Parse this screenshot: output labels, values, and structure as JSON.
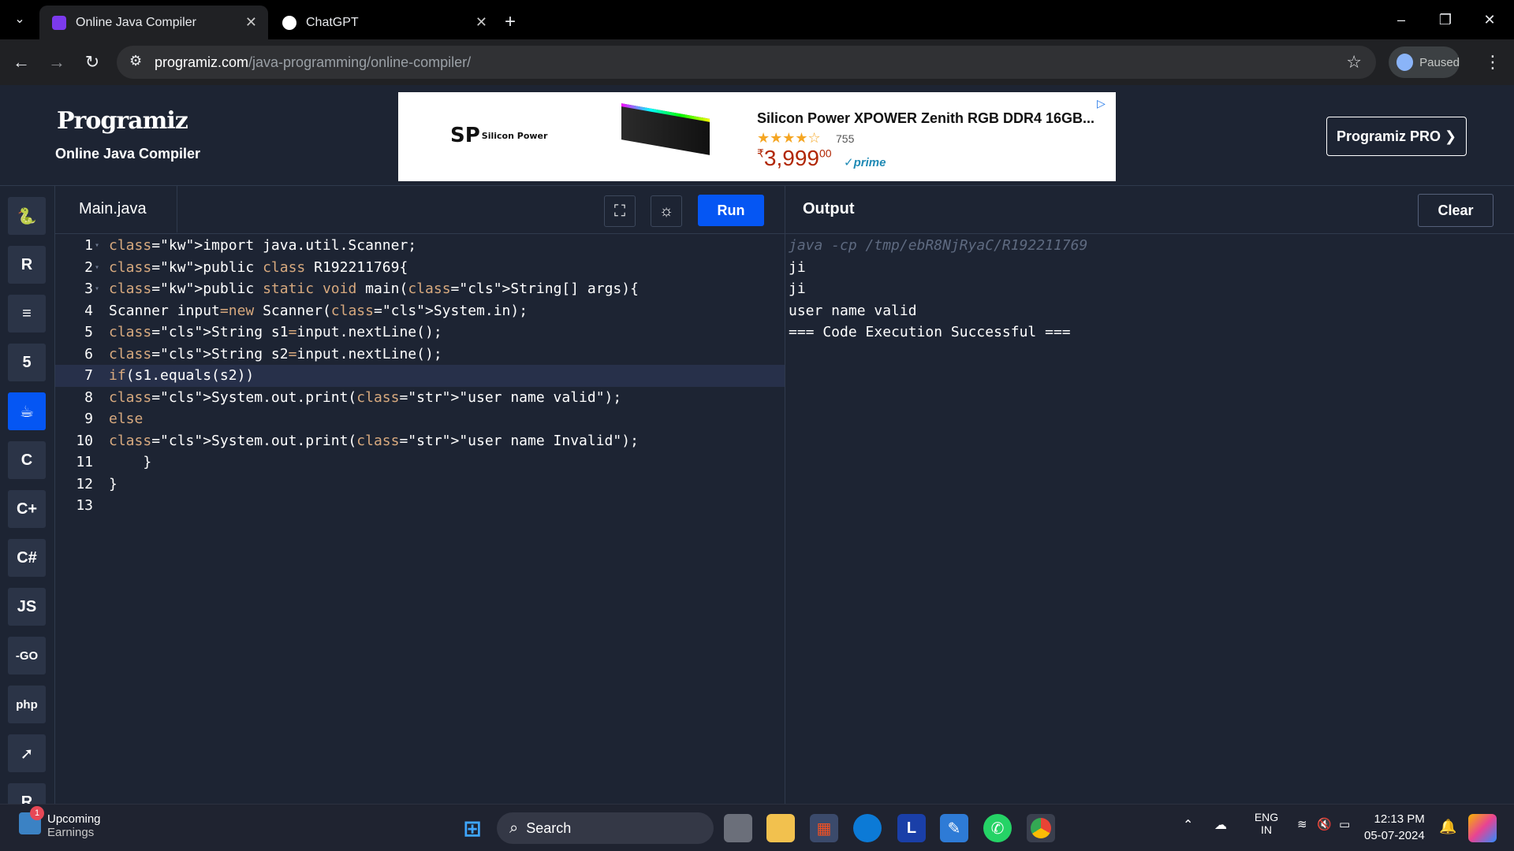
{
  "browser": {
    "tabs": [
      {
        "title": "Online Java Compiler",
        "favicon_color": "#7c3aed"
      },
      {
        "title": "ChatGPT",
        "favicon_color": "#ffffff"
      }
    ],
    "url_domain": "programiz.com",
    "url_path": "/java-programming/online-compiler/",
    "profile_status": "Paused",
    "window_controls": {
      "minimize": "–",
      "restore": "❐",
      "close": "✕"
    }
  },
  "header": {
    "logo": "Programiz",
    "subtitle": "Online Java Compiler",
    "pro_button": "Programiz PRO ❯",
    "ad": {
      "brand": "SP",
      "brand_sub": "Silicon Power",
      "title": "Silicon Power XPOWER Zenith RGB DDR4 16GB...",
      "stars": "★★★★☆",
      "rating_count": "755",
      "price_symbol": "₹",
      "price": "3,999",
      "price_cents": "00",
      "prime": "✓prime"
    }
  },
  "rail": {
    "languages": [
      {
        "name": "python",
        "glyph": "🐍",
        "active": false
      },
      {
        "name": "r",
        "glyph": "R",
        "active": false
      },
      {
        "name": "sql",
        "glyph": "≡",
        "active": false
      },
      {
        "name": "html",
        "glyph": "5",
        "active": false
      },
      {
        "name": "java",
        "glyph": "☕",
        "active": true
      },
      {
        "name": "c",
        "glyph": "C",
        "active": false
      },
      {
        "name": "cpp",
        "glyph": "C+",
        "active": false
      },
      {
        "name": "csharp",
        "glyph": "C#",
        "active": false
      },
      {
        "name": "js",
        "glyph": "JS",
        "active": false
      },
      {
        "name": "go",
        "glyph": "-GO",
        "active": false
      },
      {
        "name": "php",
        "glyph": "php",
        "active": false
      },
      {
        "name": "swift",
        "glyph": "➚",
        "active": false
      },
      {
        "name": "rust",
        "glyph": "R",
        "active": false
      }
    ]
  },
  "editor": {
    "filename": "Main.java",
    "run_label": "Run",
    "fullscreen_icon": "⛶",
    "theme_icon": "☼",
    "lines": [
      {
        "n": "1",
        "fold": "▾",
        "code": "import java.util.Scanner;"
      },
      {
        "n": "2",
        "fold": "▾",
        "code": "public class R192211769{"
      },
      {
        "n": "3",
        "fold": "▾",
        "code": "public static void main(String[] args){"
      },
      {
        "n": "4",
        "fold": "",
        "code": "Scanner input=new Scanner(System.in);"
      },
      {
        "n": "5",
        "fold": "",
        "code": "String s1=input.nextLine();"
      },
      {
        "n": "6",
        "fold": "",
        "code": "String s2=input.nextLine();"
      },
      {
        "n": "7",
        "fold": "",
        "code": "if(s1.equals(s2))"
      },
      {
        "n": "8",
        "fold": "",
        "code": "System.out.print(\"user name valid\");"
      },
      {
        "n": "9",
        "fold": "",
        "code": "else"
      },
      {
        "n": "10",
        "fold": "",
        "code": "System.out.print(\"user name Invalid\");"
      },
      {
        "n": "11",
        "fold": "",
        "code": "    }"
      },
      {
        "n": "12",
        "fold": "",
        "code": "}"
      },
      {
        "n": "13",
        "fold": "",
        "code": ""
      }
    ],
    "highlighted_line": 7
  },
  "output": {
    "title": "Output",
    "clear_label": "Clear",
    "command": "java -cp /tmp/ebR8NjRyaC/R192211769",
    "lines": [
      "ji",
      "ji",
      "user name valid",
      "=== Code Execution Successful ==="
    ]
  },
  "taskbar": {
    "weather_title": "Upcoming",
    "weather_sub": "Earnings",
    "weather_badge": "1",
    "search_label": "Search",
    "tray_lang": "ENG",
    "tray_region": "IN",
    "time": "12:13 PM",
    "date": "05-07-2024"
  }
}
